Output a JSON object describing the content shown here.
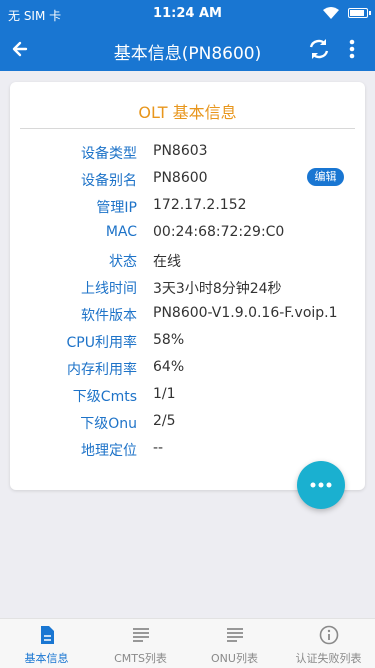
{
  "status_bar": {
    "carrier": "无 SIM 卡",
    "time": "11:24 AM",
    "battery_level": 0.9
  },
  "app_bar": {
    "title": "基本信息(PN8600)",
    "icons": [
      "back-arrow-icon",
      "refresh-icon",
      "more-vert-icon"
    ]
  },
  "card": {
    "title": "OLT 基本信息",
    "edit_label": "编辑",
    "rows": [
      {
        "label": "设备类型",
        "value": "PN8603"
      },
      {
        "label": "设备别名",
        "value": "PN8600"
      },
      {
        "label": "管理IP",
        "value": "172.17.2.152"
      },
      {
        "label": "MAC",
        "value": "00:24:68:72:29:C0"
      },
      {
        "label": "状态",
        "value": "在线"
      },
      {
        "label": "上线时间",
        "value": "3天3小时8分钟24秒"
      },
      {
        "label": "软件版本",
        "value": "PN8600-V1.9.0.16-F.voip.1"
      },
      {
        "label": "CPU利用率",
        "value": "58%"
      },
      {
        "label": "内存利用率",
        "value": "64%"
      },
      {
        "label": "下级Cmts",
        "value": "1/1"
      },
      {
        "label": "下级Onu",
        "value": "2/5"
      },
      {
        "label": "地理定位",
        "value": "--"
      }
    ]
  },
  "fab": {
    "icon": "more-horiz-icon"
  },
  "tabs": [
    {
      "label": "基本信息",
      "icon": "document-icon",
      "active": true
    },
    {
      "label": "CMTS列表",
      "icon": "list-icon",
      "active": false
    },
    {
      "label": "ONU列表",
      "icon": "list-icon",
      "active": false
    },
    {
      "label": "认证失败列表",
      "icon": "info-icon",
      "active": false
    }
  ],
  "colors": {
    "primary": "#1976d2",
    "accent_title": "#e8961c",
    "label": "#1e73c8",
    "fab": "#1ab0d0",
    "background": "#ededf2"
  }
}
